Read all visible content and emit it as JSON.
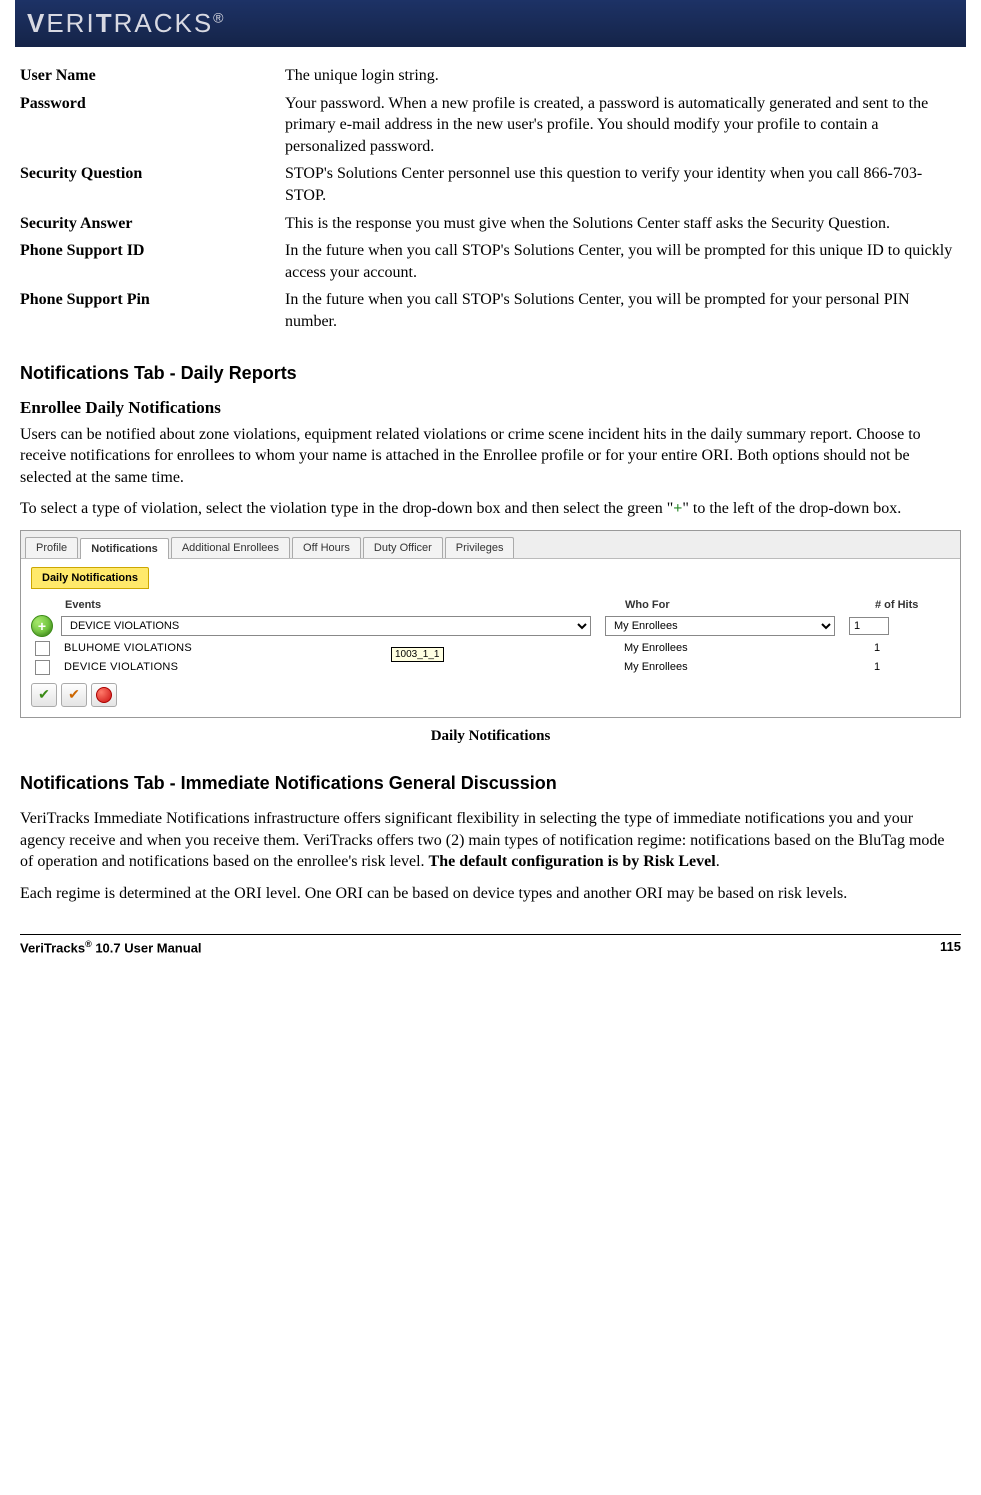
{
  "logo": "VERITRACKS®",
  "defs": [
    {
      "term": "User Name",
      "desc": "The unique login string."
    },
    {
      "term": "Password",
      "desc": "Your password. When a new profile is created, a password is automatically generated and sent to the primary e-mail address in the new user's profile.  You should modify your profile to contain a personalized password."
    },
    {
      "term": "Security Question",
      "desc": "STOP's Solutions Center personnel use this question to verify your identity when you call 866-703-STOP."
    },
    {
      "term": "Security Answer",
      "desc": "This is the response you must give when the Solutions Center staff asks the Security Question."
    },
    {
      "term": "Phone Support ID",
      "desc": "In the future when you call STOP's Solutions Center, you will be prompted for this unique ID to quickly access your account."
    },
    {
      "term": "Phone Support Pin",
      "desc": "In the future when you call STOP's Solutions Center, you will be prompted for your personal PIN number."
    }
  ],
  "section1_heading": "Notifications Tab - Daily Reports",
  "section1_sub": "Enrollee Daily Notifications",
  "section1_p1": "Users can be notified about zone violations, equipment related violations or crime scene incident hits in the daily summary report. Choose to receive notifications for enrollees to whom your name is attached in the Enrollee profile or for your entire ORI. Both options should not be selected at the same time.",
  "section1_p2a": "To select a type of violation, select the violation type in the drop-down box and then select the green \"",
  "section1_p2_plus": "+",
  "section1_p2b": "\" to the left of the drop-down box.",
  "ui_tabs": [
    "Profile",
    "Notifications",
    "Additional Enrollees",
    "Off Hours",
    "Duty Officer",
    "Privileges"
  ],
  "daily_tab_label": "Daily Notifications",
  "col_events": "Events",
  "col_who": "Who For",
  "col_hits": "# of Hits",
  "dd_events_value": "DEVICE VIOLATIONS",
  "dd_who_value": "My Enrollees",
  "hits_value": "1",
  "rows": [
    {
      "event": "BLUHOME VIOLATIONS",
      "who": "My Enrollees",
      "hits": "1"
    },
    {
      "event": "DEVICE VIOLATIONS",
      "who": "My Enrollees",
      "hits": "1"
    }
  ],
  "tooltip": "1003_1_1",
  "caption": "Daily Notifications",
  "section2_heading": "Notifications Tab - Immediate Notifications General Discussion",
  "section2_p1a": "VeriTracks Immediate Notifications infrastructure offers significant flexibility in selecting the type of immediate notifications you and your agency receive and when you receive them.  VeriTracks offers two (2) main types of notification regime: notifications based on the BluTag mode of operation and notifications based on the enrollee's risk level.  ",
  "section2_p1b": "The default configuration is by Risk Level",
  "section2_p1c": ".",
  "section2_p2": "Each regime is determined at the ORI level.  One ORI can be based on device types and another ORI may be based on risk levels.",
  "footer_left_a": "VeriTracks",
  "footer_left_b": " 10.7 User Manual",
  "footer_right": "115"
}
